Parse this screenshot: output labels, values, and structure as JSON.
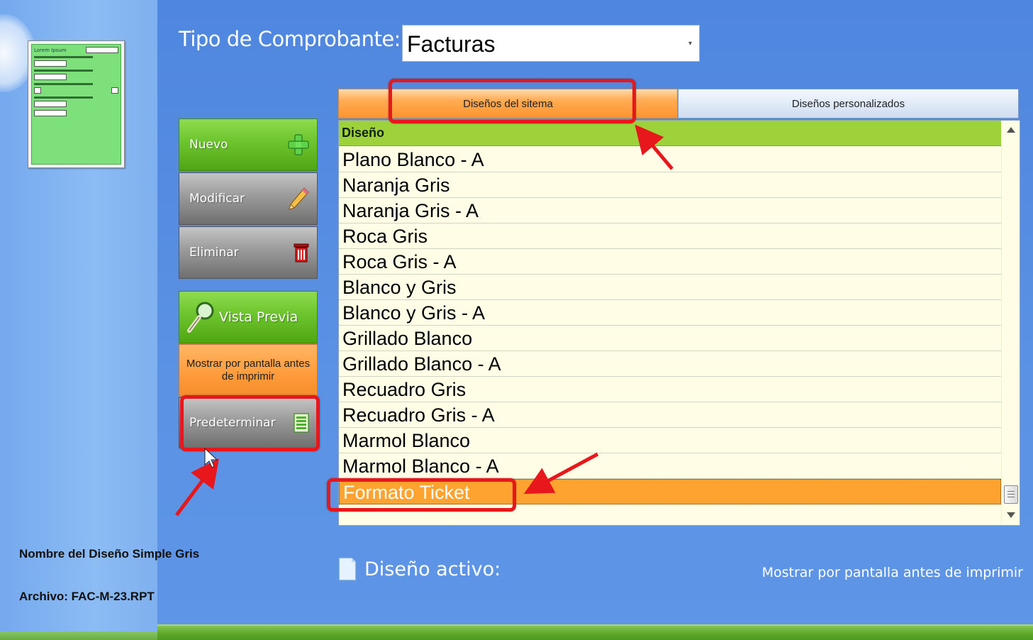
{
  "selector": {
    "label": "Tipo de Comprobante:",
    "value": "Facturas"
  },
  "buttons": {
    "nuevo": "Nuevo",
    "modificar": "Modificar",
    "eliminar": "Eliminar",
    "vista_previa": "Vista Previa",
    "mostrar": "Mostrar por pantalla antes de imprimir",
    "predeterminar": "Predeterminar"
  },
  "tabs": {
    "sistema": "Diseños del sitema",
    "personalizados": "Diseños personalizados"
  },
  "list": {
    "header": "Diseño",
    "rows": [
      "Plano Blanco - A",
      "Naranja Gris",
      "Naranja Gris - A",
      "Roca Gris",
      "Roca Gris - A",
      "Blanco y Gris",
      "Blanco y Gris - A",
      "Grillado Blanco",
      "Grillado Blanco - A",
      "Recuadro Gris",
      "Recuadro Gris - A",
      "Marmol Blanco",
      "Marmol Blanco - A",
      "Formato Ticket"
    ],
    "selected": "Formato Ticket"
  },
  "info": {
    "nombre": "Nombre del Diseño Simple Gris",
    "archivo": "Archivo: FAC-M-23.RPT"
  },
  "active": {
    "label": "Diseño activo:",
    "mostrar": "Mostrar por pantalla antes de imprimir"
  },
  "thumbnail": {
    "title": "Lorem Ipsum"
  },
  "colors": {
    "highlight": "#e8171b",
    "selected_row": "#ffa330",
    "header_green": "#9ed23a"
  }
}
